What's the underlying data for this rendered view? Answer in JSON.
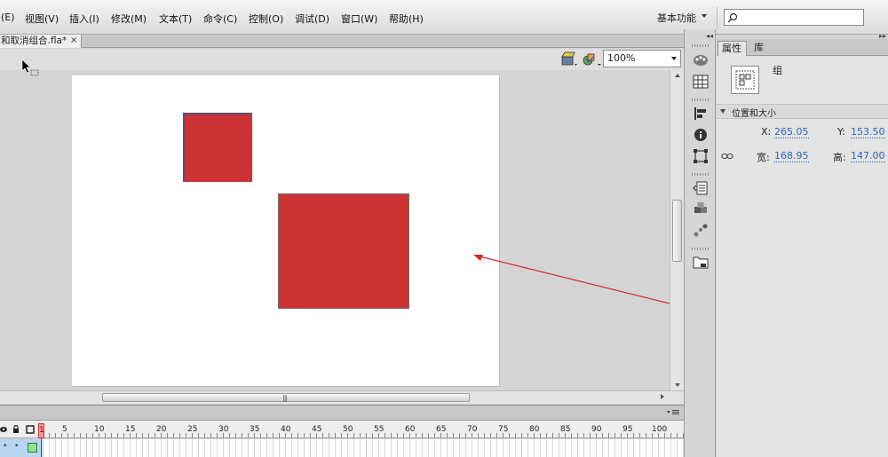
{
  "menu": {
    "items": [
      "(E)",
      "视图(V)",
      "插入(I)",
      "修改(M)",
      "文本(T)",
      "命令(C)",
      "控制(O)",
      "调试(D)",
      "窗口(W)",
      "帮助(H)"
    ],
    "workspace": "基本功能",
    "search_placeholder": ""
  },
  "document": {
    "tab_title": "和取消组合.fla*",
    "tab_close": "×"
  },
  "editbar": {
    "zoom": "100%"
  },
  "stage": {
    "background": "#ffffff",
    "shape_color": "#cd3234"
  },
  "timeline": {
    "frame_numbers": [
      "5",
      "10",
      "15",
      "20",
      "25",
      "30",
      "35",
      "40",
      "45",
      "50",
      "55",
      "60",
      "65",
      "70",
      "75",
      "80",
      "85",
      "90",
      "95",
      "100"
    ],
    "current_frame": "1"
  },
  "properties": {
    "tabs": [
      "属性",
      "库"
    ],
    "instance_type": "组",
    "section_title": "位置和大小",
    "x_label": "X:",
    "x_value": "265.05",
    "y_label": "Y:",
    "y_value": "153.50",
    "width_label": "宽:",
    "width_value": "168.95",
    "height_label": "高:",
    "height_value": "147.00"
  },
  "colors": {
    "accent_link": "#2a64b8",
    "annotation_arrow": "#d42a2a",
    "keyframe": "#8fe08f"
  }
}
